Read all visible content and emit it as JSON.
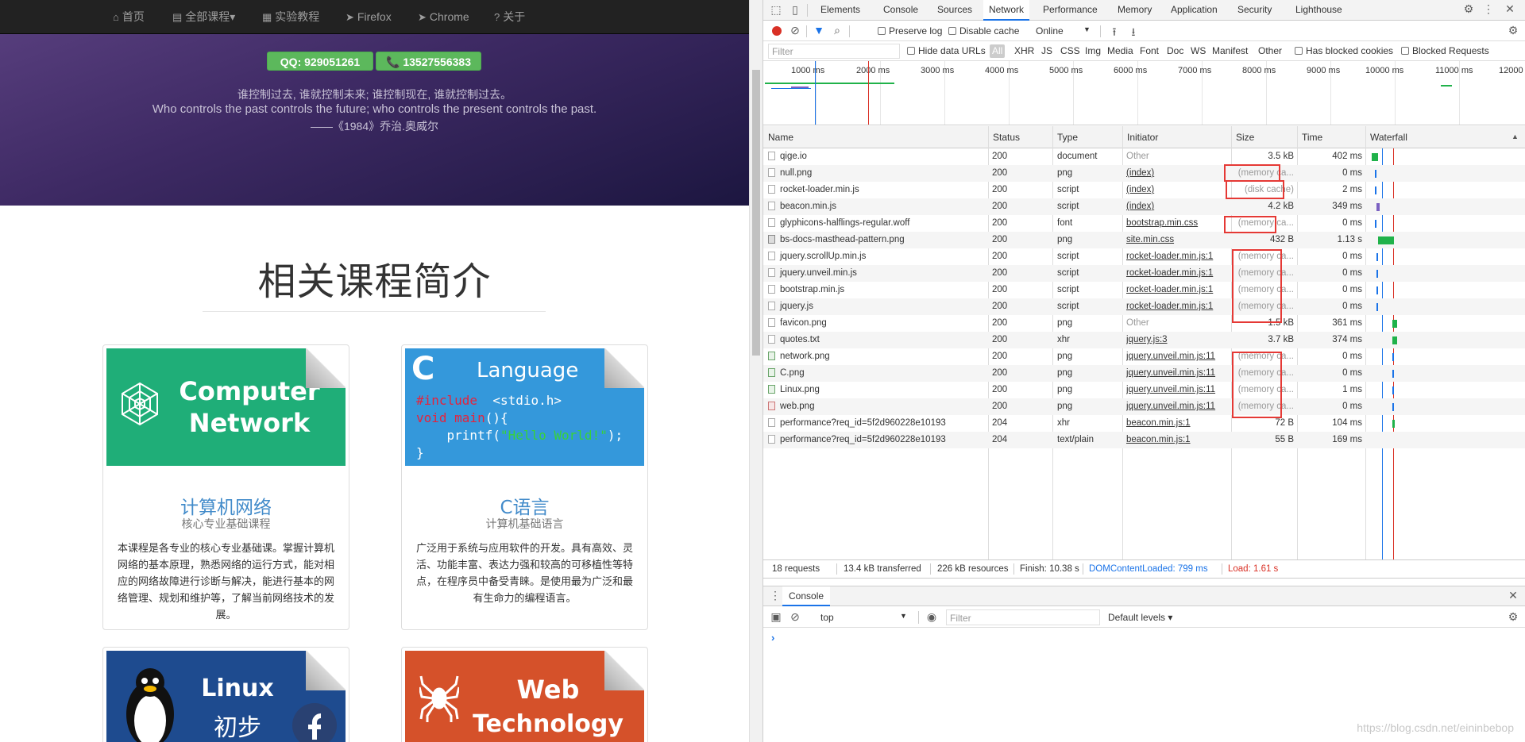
{
  "site": {
    "nav": [
      {
        "icon": "home-icon",
        "glyph": "⌂",
        "label": "首页"
      },
      {
        "icon": "book-icon",
        "glyph": "▤",
        "label": "全部课程▾"
      },
      {
        "icon": "grid-icon",
        "glyph": "▦",
        "label": "实验教程"
      },
      {
        "icon": "send-icon",
        "glyph": "➤",
        "label": "Firefox"
      },
      {
        "icon": "send-icon",
        "glyph": "➤",
        "label": "Chrome"
      },
      {
        "icon": "question-icon",
        "glyph": "?",
        "label": "关于"
      }
    ],
    "contact": {
      "qq": "QQ: 929051261",
      "phone": "📞 13527556383"
    },
    "quote": {
      "cn": "谁控制过去, 谁就控制未来; 谁控制现在, 谁就控制过去。",
      "en": "Who controls the past controls the future; who controls the present controls the past.",
      "source": "——《1984》乔治.奥威尔"
    },
    "section_title": "相关课程简介",
    "cards": [
      {
        "thumb_line1": "Computer",
        "thumb_line2": "Network",
        "title": "计算机网络",
        "subtitle": "核心专业基础课程",
        "desc": "本课程是各专业的核心专业基础课。掌握计算机网络的基本原理，熟悉网络的运行方式，能对相应的网络故障进行诊断与解决，能进行基本的网络管理、规划和维护等，了解当前网络技术的发展。"
      },
      {
        "thumb_letter": "C",
        "thumb_title": "Language",
        "code_include_kw": "#include",
        "code_include_rest": "  <stdio.h>",
        "code_void": "void",
        "code_main": " main",
        "code_brace": "(){",
        "code_printf": "    printf(",
        "code_string": "\"Hello World!\"",
        "code_end": ");",
        "code_close": "}",
        "title": "C语言",
        "subtitle": "计算机基础语言",
        "desc": "广泛用于系统与应用软件的开发。具有高效、灵活、功能丰富、表达力强和较高的可移植性等特点，在程序员中备受青睐。是使用最为广泛和最有生命力的编程语言。"
      },
      {
        "thumb_line1": "Linux",
        "thumb_line2": "初步"
      },
      {
        "thumb_line1": "Web",
        "thumb_line2": "Technology"
      }
    ]
  },
  "devtools": {
    "tabs": [
      "Elements",
      "Console",
      "Sources",
      "Network",
      "Performance",
      "Memory",
      "Application",
      "Security",
      "Lighthouse"
    ],
    "active_tab": "Network",
    "toolbar": {
      "preserve_log": "Preserve log",
      "disable_cache": "Disable cache",
      "throttle": "Online"
    },
    "filterbar": {
      "placeholder": "Filter",
      "hide_data_urls": "Hide data URLs",
      "types": [
        "All",
        "XHR",
        "JS",
        "CSS",
        "Img",
        "Media",
        "Font",
        "Doc",
        "WS",
        "Manifest",
        "Other"
      ],
      "has_blocked": "Has blocked cookies",
      "blocked_requests": "Blocked Requests"
    },
    "overview_ticks": [
      "1000 ms",
      "2000 ms",
      "3000 ms",
      "4000 ms",
      "5000 ms",
      "6000 ms",
      "7000 ms",
      "8000 ms",
      "9000 ms",
      "10000 ms",
      "11000 ms",
      "12000"
    ],
    "columns": [
      "Name",
      "Status",
      "Type",
      "Initiator",
      "Size",
      "Time",
      "Waterfall"
    ],
    "requests": [
      {
        "name": "qige.io",
        "status": "200",
        "type": "document",
        "initiator": "Other",
        "size": "3.5 kB",
        "time": "402 ms",
        "icon": "doc"
      },
      {
        "name": "null.png",
        "status": "200",
        "type": "png",
        "initiator": "(index)",
        "size": "(memory ca...",
        "time": "0 ms",
        "icon": "doc"
      },
      {
        "name": "rocket-loader.min.js",
        "status": "200",
        "type": "script",
        "initiator": "(index)",
        "size": "(disk cache)",
        "time": "2 ms",
        "icon": "doc"
      },
      {
        "name": "beacon.min.js",
        "status": "200",
        "type": "script",
        "initiator": "(index)",
        "size": "4.2 kB",
        "time": "349 ms",
        "icon": "doc"
      },
      {
        "name": "glyphicons-halflings-regular.woff",
        "status": "200",
        "type": "font",
        "initiator": "bootstrap.min.css",
        "size": "(memory ca...",
        "time": "0 ms",
        "icon": "doc"
      },
      {
        "name": "bs-docs-masthead-pattern.png",
        "status": "200",
        "type": "png",
        "initiator": "site.min.css",
        "size": "432 B",
        "time": "1.13 s",
        "icon": "pic"
      },
      {
        "name": "jquery.scrollUp.min.js",
        "status": "200",
        "type": "script",
        "initiator": "rocket-loader.min.js:1",
        "size": "(memory ca...",
        "time": "0 ms",
        "icon": "doc"
      },
      {
        "name": "jquery.unveil.min.js",
        "status": "200",
        "type": "script",
        "initiator": "rocket-loader.min.js:1",
        "size": "(memory ca...",
        "time": "0 ms",
        "icon": "doc"
      },
      {
        "name": "bootstrap.min.js",
        "status": "200",
        "type": "script",
        "initiator": "rocket-loader.min.js:1",
        "size": "(memory ca...",
        "time": "0 ms",
        "icon": "doc"
      },
      {
        "name": "jquery.js",
        "status": "200",
        "type": "script",
        "initiator": "rocket-loader.min.js:1",
        "size": "(memory ca...",
        "time": "0 ms",
        "icon": "doc"
      },
      {
        "name": "favicon.png",
        "status": "200",
        "type": "png",
        "initiator": "Other",
        "size": "1.5 kB",
        "time": "361 ms",
        "icon": "doc"
      },
      {
        "name": "quotes.txt",
        "status": "200",
        "type": "xhr",
        "initiator": "jquery.js:3",
        "size": "3.7 kB",
        "time": "374 ms",
        "icon": "doc"
      },
      {
        "name": "network.png",
        "status": "200",
        "type": "png",
        "initiator": "jquery.unveil.min.js:11",
        "size": "(memory ca...",
        "time": "0 ms",
        "icon": "img"
      },
      {
        "name": "C.png",
        "status": "200",
        "type": "png",
        "initiator": "jquery.unveil.min.js:11",
        "size": "(memory ca...",
        "time": "0 ms",
        "icon": "img"
      },
      {
        "name": "Linux.png",
        "status": "200",
        "type": "png",
        "initiator": "jquery.unveil.min.js:11",
        "size": "(memory ca...",
        "time": "1 ms",
        "icon": "img"
      },
      {
        "name": "web.png",
        "status": "200",
        "type": "png",
        "initiator": "jquery.unveil.min.js:11",
        "size": "(memory ca...",
        "time": "0 ms",
        "icon": "img2"
      },
      {
        "name": "performance?req_id=5f2d960228e10193",
        "status": "204",
        "type": "xhr",
        "initiator": "beacon.min.js:1",
        "size": "72 B",
        "time": "104 ms",
        "icon": "doc"
      },
      {
        "name": "performance?req_id=5f2d960228e10193",
        "status": "204",
        "type": "text/plain",
        "initiator": "beacon.min.js:1",
        "size": "55 B",
        "time": "169 ms",
        "icon": "doc"
      }
    ],
    "summary": {
      "requests": "18 requests",
      "transferred": "13.4 kB transferred",
      "resources": "226 kB resources",
      "finish": "Finish: 10.38 s",
      "dcl": "DOMContentLoaded: 799 ms",
      "load": "Load: 1.61 s"
    },
    "drawer": {
      "tab": "Console",
      "context": "top",
      "filter_placeholder": "Filter",
      "levels": "Default levels ▾",
      "prompt": "›"
    }
  },
  "colors": {
    "dcl_blue": "#1a73e8",
    "load_red": "#d93025",
    "highlight_box": "#e53935",
    "success_green": "#5cb85c"
  },
  "watermark": "https://blog.csdn.net/eininbebop"
}
